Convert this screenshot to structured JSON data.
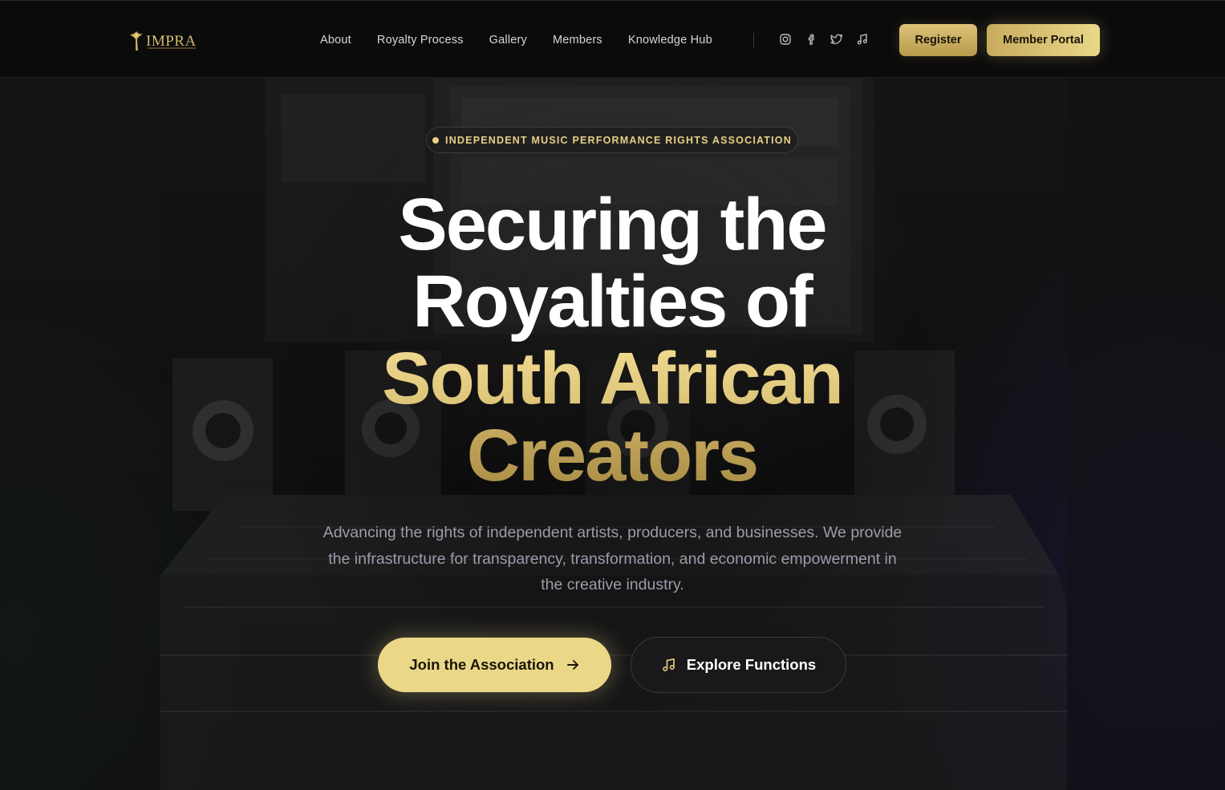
{
  "brand": {
    "name": "IMPRA",
    "accent": "#e8d38a"
  },
  "nav": {
    "items": [
      {
        "label": "About"
      },
      {
        "label": "Royalty Process"
      },
      {
        "label": "Gallery"
      },
      {
        "label": "Members"
      },
      {
        "label": "Knowledge Hub"
      }
    ],
    "socials": [
      "instagram-icon",
      "facebook-icon",
      "twitter-icon",
      "music-note-icon"
    ],
    "register_label": "Register",
    "portal_label": "Member Portal"
  },
  "hero": {
    "badge": "INDEPENDENT MUSIC PERFORMANCE RIGHTS ASSOCIATION",
    "headline": {
      "line1": "Securing the",
      "line2": "Royalties of",
      "line3": "South African",
      "line4": "Creators"
    },
    "description": "Advancing the rights of independent artists, producers, and businesses. We provide the infrastructure for transparency, transformation, and economic empowerment in the creative industry.",
    "cta_primary": "Join the Association",
    "cta_secondary": "Explore Functions"
  },
  "colors": {
    "background": "#0c0c0e",
    "gold_light": "#ead888",
    "gold_dark": "#b89a4c",
    "muted_text": "#9c9cab"
  }
}
